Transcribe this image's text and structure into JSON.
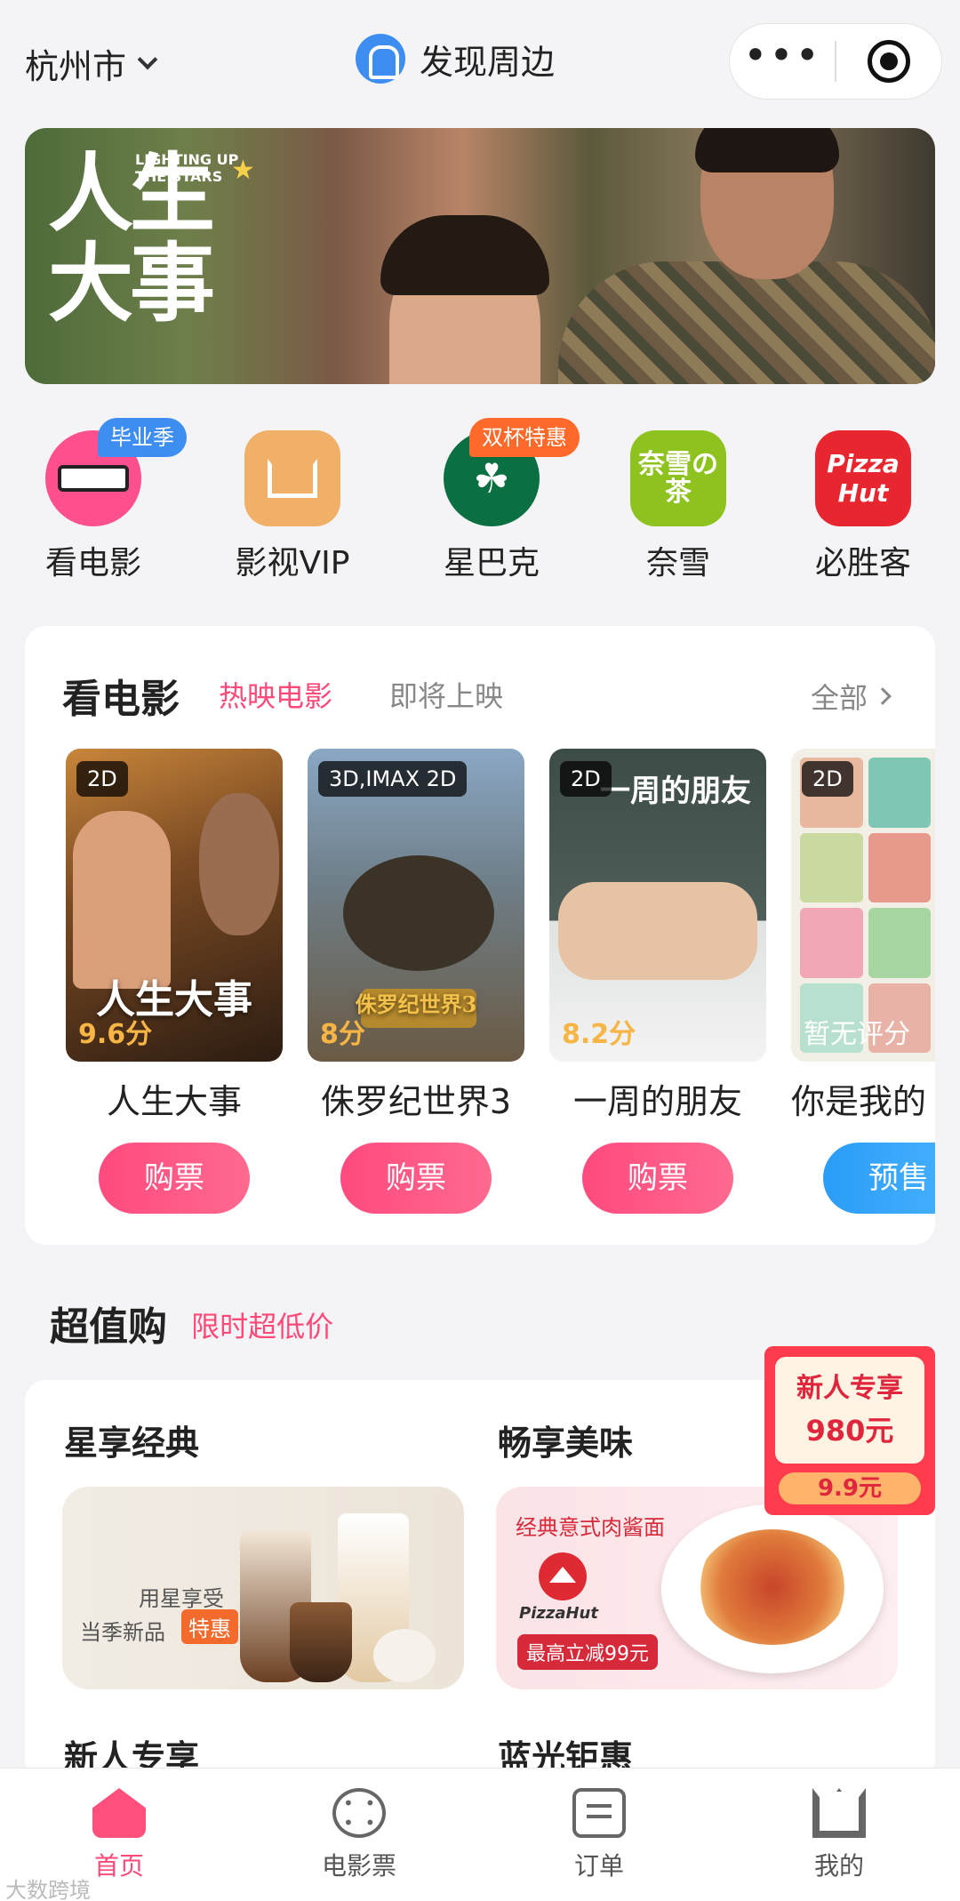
{
  "header": {
    "city": "杭州市",
    "title": "发现周边"
  },
  "banner": {
    "title_cn": "人生大事",
    "title_en": "LIGHTING UP THE STARS"
  },
  "quick_entries": [
    {
      "label": "看电影",
      "badge": "毕业季",
      "badge_color": "#3d8ef0",
      "icon": "glasses-icon"
    },
    {
      "label": "影视VIP",
      "badge": "",
      "icon": "crown-icon"
    },
    {
      "label": "星巴克",
      "badge": "双杯特惠",
      "badge_color": "#ff6a2b",
      "icon": "starbucks-logo-icon"
    },
    {
      "label": "奈雪",
      "badge": "",
      "icon": "nayuki-logo-icon",
      "logo_text": "奈雪の茶"
    },
    {
      "label": "必胜客",
      "badge": "",
      "icon": "pizza-hut-logo-icon",
      "logo_text": "Pizza Hut"
    }
  ],
  "movies_section": {
    "title": "看电影",
    "tab_active": "热映电影",
    "tab_inactive": "即将上映",
    "all": "全部",
    "movies": [
      {
        "format": "2D",
        "score": "9.6分",
        "name": "人生大事",
        "action": "购票",
        "poster_text": "人生大事"
      },
      {
        "format": "3D,IMAX 2D",
        "score": "8分",
        "name": "侏罗纪世界3",
        "action": "购票",
        "poster_text": "侏罗纪世界3"
      },
      {
        "format": "2D",
        "score": "8.2分",
        "name": "一周的朋友",
        "action": "购票",
        "poster_text": "一周的朋友"
      },
      {
        "format": "2D",
        "score": "暂无评分",
        "name": "你是我的",
        "action": "预售",
        "poster_text": ""
      }
    ]
  },
  "value_section": {
    "title": "超值购",
    "subtitle": "限时超低价",
    "cards": [
      {
        "title": "星享经典",
        "line1": "用星享受",
        "line2": "当季新品",
        "tag": "特惠"
      },
      {
        "title": "畅享美味",
        "headline": "经典意式肉酱面",
        "brand": "PizzaHut",
        "offer": "最高立减99元"
      }
    ],
    "next_titles": [
      "新人专享",
      "蓝光钜惠"
    ]
  },
  "newbie_badge": {
    "line1": "新人专享",
    "line2": "980元",
    "price": "9.9元"
  },
  "tabbar": [
    {
      "label": "首页",
      "active": true
    },
    {
      "label": "电影票",
      "active": false
    },
    {
      "label": "订单",
      "active": false
    },
    {
      "label": "我的",
      "active": false
    }
  ],
  "watermark": "大数跨境",
  "colors": {
    "accent": "#ff4978",
    "blue": "#3d8ef0"
  }
}
